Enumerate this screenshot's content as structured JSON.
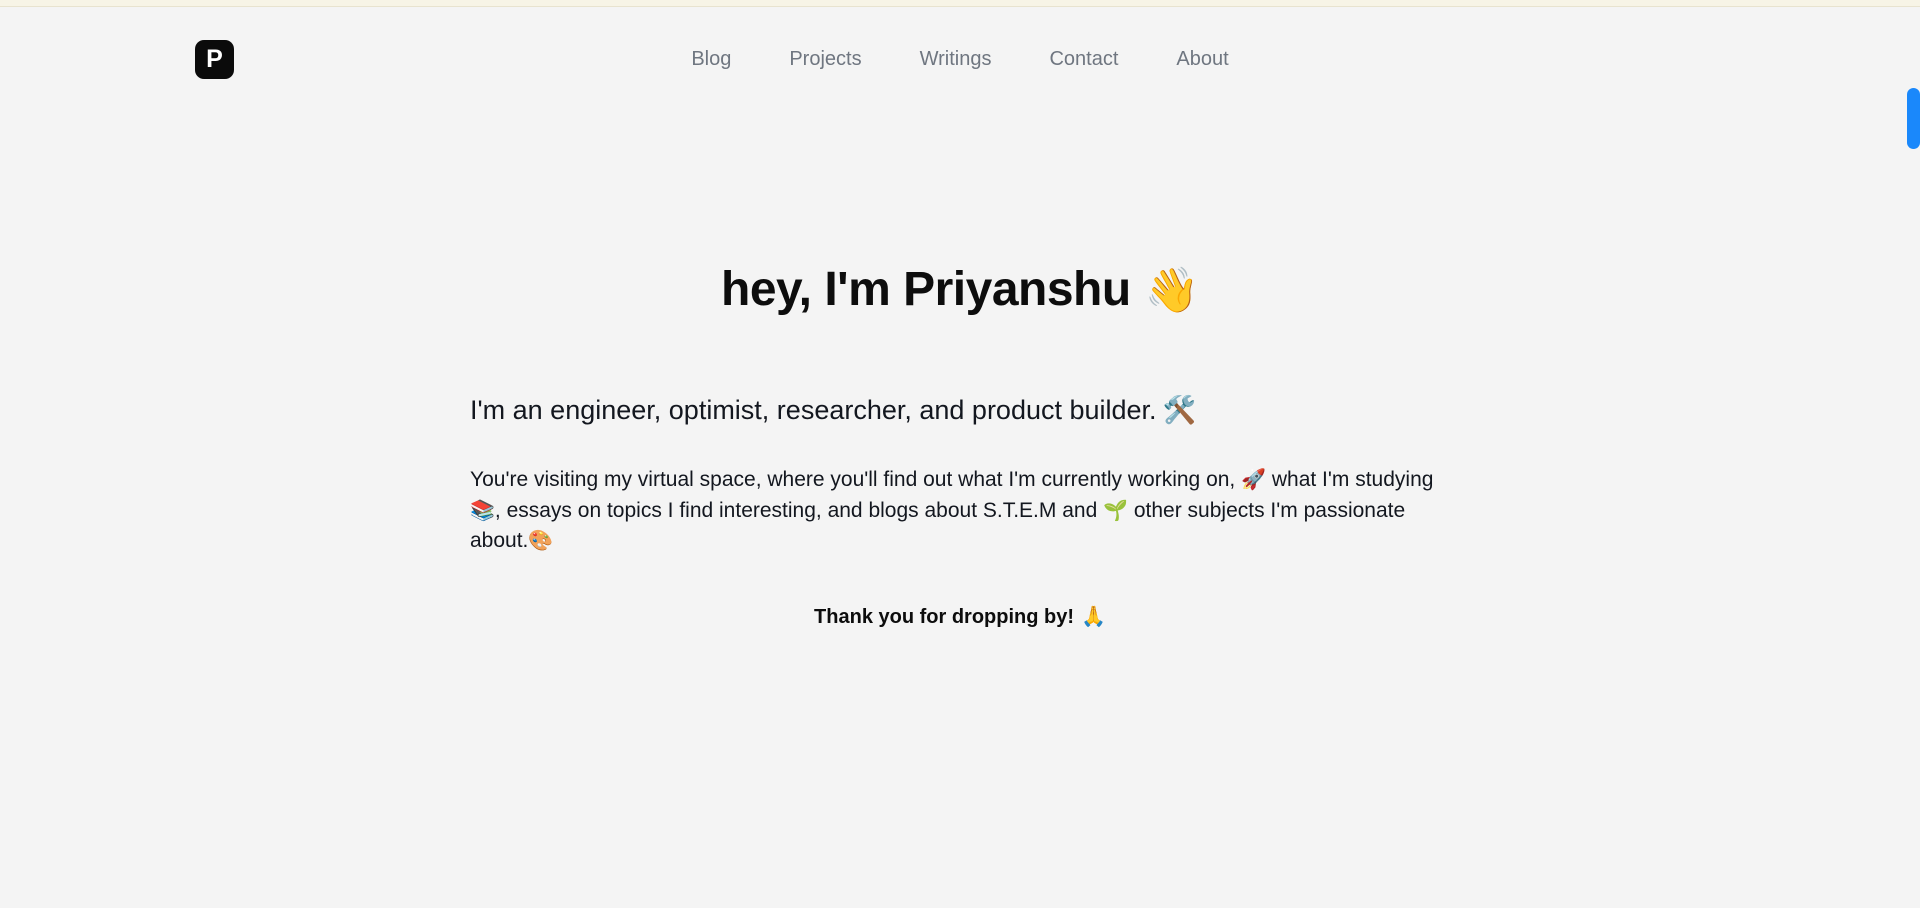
{
  "colors": {
    "page_background": "#f4f4f4",
    "top_strip": "#f7f4e6",
    "logo_background": "#0b0b0b",
    "logo_text": "#ffffff",
    "nav_text": "#6f7680",
    "body_text": "#13171f",
    "heading_text": "#0d0d0d",
    "scrollbar_thumb": "#1a88fb"
  },
  "header": {
    "logo_letter": "P",
    "nav": [
      {
        "label": "Blog"
      },
      {
        "label": "Projects"
      },
      {
        "label": "Writings"
      },
      {
        "label": "Contact"
      },
      {
        "label": "About"
      }
    ]
  },
  "main": {
    "heading_text": "hey, I'm Priyanshu",
    "heading_emoji": "👋",
    "tagline_text": "I'm an engineer, optimist, researcher, and product builder.",
    "tagline_emoji": "🛠️",
    "intro": {
      "part1": "You're visiting my virtual space, where you'll find out what I'm currently working on,",
      "emoji1": "🚀",
      "part2": "what I'm studying",
      "emoji2": "📚",
      "part3": ", essays on topics I find interesting, and blogs about S.T.E.M and",
      "emoji3": "🌱",
      "part4": "other subjects I'm passionate about.",
      "emoji4": "🎨"
    },
    "thanks_text": "Thank you for dropping by!",
    "thanks_emoji": "🙏"
  },
  "scrollbar": {
    "name": "vertical-scrollbar"
  }
}
